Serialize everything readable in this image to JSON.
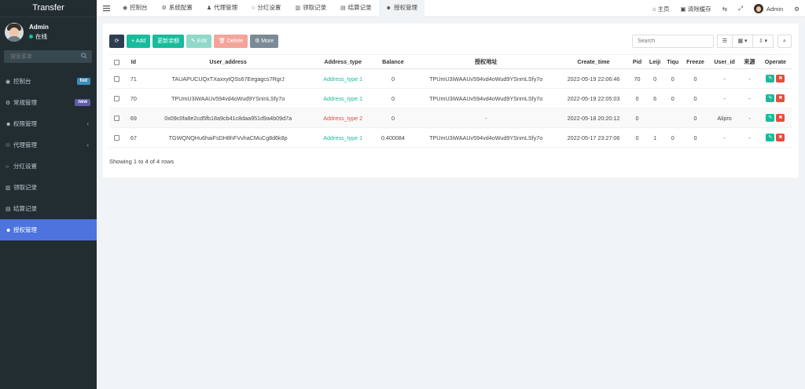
{
  "sidebar": {
    "brand": "Transfer",
    "user": {
      "name": "Admin",
      "status": "在线"
    },
    "search_placeholder": "搜索菜单",
    "items": [
      {
        "label": "控制台",
        "icon": "dashboard-icon",
        "glyph": "◉",
        "badge": "hot",
        "badge_color": "#3c8dbc"
      },
      {
        "label": "常规管理",
        "icon": "cogs-icon",
        "glyph": "⚙",
        "badge": "new",
        "badge_color": "#605ca8"
      },
      {
        "label": "权限管理",
        "icon": "group-icon",
        "glyph": "☻",
        "chevron": "‹"
      },
      {
        "label": "代理管理",
        "icon": "user-circle-icon",
        "glyph": "☉",
        "chevron": "‹"
      },
      {
        "label": "分红设置",
        "icon": "circle-icon",
        "glyph": "○"
      },
      {
        "label": "领取记录",
        "icon": "bank-icon",
        "glyph": "▥"
      },
      {
        "label": "结算记录",
        "icon": "list-icon",
        "glyph": "▤"
      },
      {
        "label": "授权管理",
        "icon": "users-icon",
        "glyph": "☻",
        "active": true
      }
    ]
  },
  "topnav": {
    "tabs": [
      {
        "label": "控制台",
        "glyph": "◉"
      },
      {
        "label": "系统配置",
        "glyph": "⚙"
      },
      {
        "label": "代理管理",
        "glyph": "♟"
      },
      {
        "label": "分红设置",
        "glyph": "○"
      },
      {
        "label": "领取记录",
        "glyph": "▥"
      },
      {
        "label": "结算记录",
        "glyph": "▤"
      },
      {
        "label": "授权管理",
        "glyph": "☻",
        "active": true
      }
    ],
    "right": {
      "home": "主页",
      "clear_cache": "清除缓存",
      "admin": "Admin"
    }
  },
  "toolbar": {
    "refresh_glyph": "⟳",
    "add": "+ Add",
    "update_balance": "更新余额",
    "edit": "✎ Edit",
    "delete": "🗑 Delete",
    "more": "⚙ More",
    "search_placeholder": "Search"
  },
  "table": {
    "columns": [
      "Id",
      "User_address",
      "Address_type",
      "Balance",
      "授权地址",
      "Create_time",
      "Pid",
      "Leiji",
      "Tiqu",
      "Freeze",
      "User_id",
      "来源",
      "Operate"
    ],
    "rows": [
      {
        "id": "71",
        "user_address": "TAUAPUCUQxTXaxxytQSs67Eegagcs7RgrJ",
        "address_type": "Address_type 1",
        "type_color": "green",
        "balance": "0",
        "auth_address": "TPUmU3iWAAUv594vd4oWud9YSnmLSfy7o",
        "create_time": "2022-05-19 22:06:46",
        "pid": "70",
        "leiji": "0",
        "tiqu": "0",
        "freeze": "0",
        "user_id": "-",
        "source": "-"
      },
      {
        "id": "70",
        "user_address": "TPUmU3iWAAUv594vd4oWud9YSnmLSfy7o",
        "address_type": "Address_type 1",
        "type_color": "green",
        "balance": "0",
        "auth_address": "TPUmU3iWAAUv594vd4oWud9YSnmLSfy7o",
        "create_time": "2022-05-19 22:05:03",
        "pid": "0",
        "leiji": "6",
        "tiqu": "0",
        "freeze": "0",
        "user_id": "-",
        "source": "-"
      },
      {
        "id": "69",
        "user_address": "0x09c0fa8e2cd5fb18a9cb41c8daa951d9a4b09d7a",
        "address_type": "Address_type 2",
        "type_color": "red",
        "balance": "0",
        "auth_address": "-",
        "create_time": "2022-05-18 20:20:12",
        "pid": "0",
        "leiji": "",
        "tiqu": "",
        "freeze": "0",
        "user_id": "Alipro",
        "source": "-"
      },
      {
        "id": "67",
        "user_address": "TGWQNQHu6haiFsDH8hFVvhaCMuCg8d6k8p",
        "address_type": "Address_type 1",
        "type_color": "green",
        "balance": "0.400084",
        "auth_address": "TPUmU3iWAAUv594vd4oWud9YSnmLSfy7o",
        "create_time": "2022-05-17 23:27:06",
        "pid": "0",
        "leiji": "1",
        "tiqu": "0",
        "freeze": "0",
        "user_id": "-",
        "source": "-"
      }
    ],
    "footer": "Showing 1 to 4 of 4 rows"
  },
  "colors": {
    "accent": "#4e73df",
    "success": "#18bc9c",
    "danger": "#e74c3c",
    "sidebar_bg": "#222d32"
  }
}
